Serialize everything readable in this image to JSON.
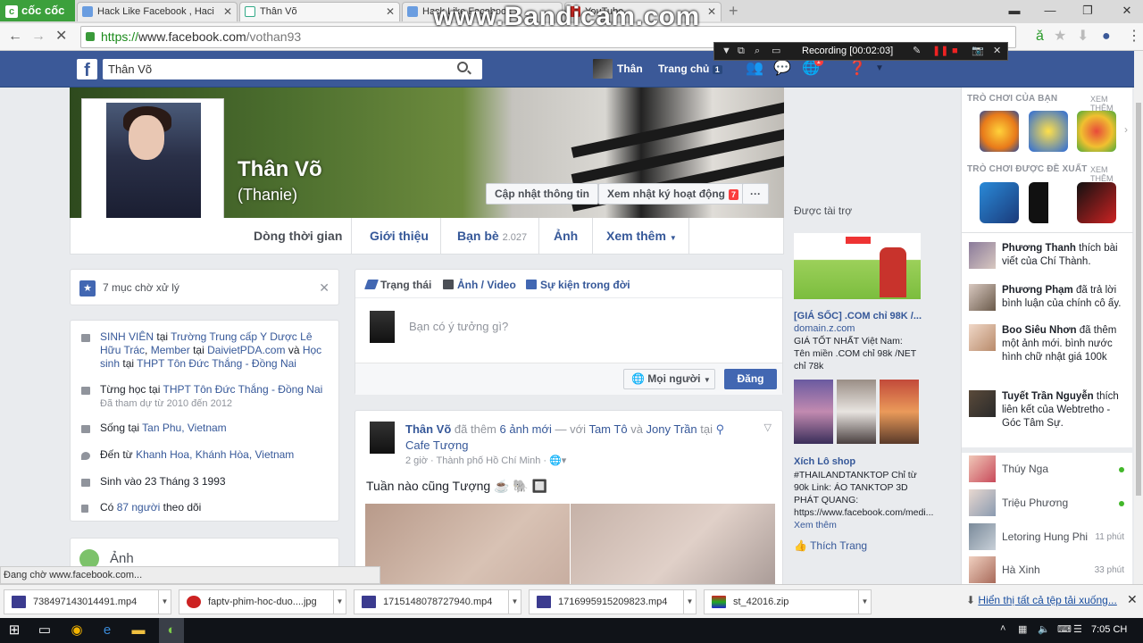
{
  "browser": {
    "brand": "cốc cốc",
    "tabs": [
      {
        "title": "Hack Like Facebook , Haci",
        "active": false
      },
      {
        "title": "Thân Võ",
        "active": true
      },
      {
        "title": "Hack Like Facebook",
        "active": false
      },
      {
        "title": "YouTube",
        "active": false
      }
    ],
    "url_scheme": "https://",
    "url_host": "www.facebook.com",
    "url_path": "/vothan93",
    "status_text": "Đang chờ www.facebook.com..."
  },
  "recorder": {
    "watermark": "www.Bandicam.com",
    "recording_label": "Recording [00:02:03]"
  },
  "fb_header": {
    "search_value": "Thân Võ",
    "profile_link": "Thân",
    "home_link": "Trang chủ",
    "home_count": "1",
    "notif_count": "1"
  },
  "profile": {
    "name": "Thân Võ",
    "alternate_name": "(Thanie)",
    "update_info_btn": "Cập nhật thông tin",
    "activity_log_btn": "Xem nhật ký hoạt động",
    "activity_log_count": "7",
    "more_btn": "···",
    "tabs": {
      "timeline": "Dòng thời gian",
      "about": "Giới thiệu",
      "friends": "Bạn bè",
      "friends_count": "2.027",
      "photos": "Ảnh",
      "more": "Xem thêm"
    }
  },
  "pending": {
    "label": "7 mục chờ xử lý"
  },
  "intro": {
    "work_1": "SINH VIÊN",
    "work_at": "tại",
    "work_2": "Trường Trung cấp Y Dược Lê Hữu Trác",
    "work_3": "Member",
    "work_4": "DaivietPDA.com",
    "work_and": "và",
    "work_5": "Học sinh",
    "work_6": "THPT Tôn Đức Thắng - Đồng Nai",
    "edu_prefix": "Từng học tại",
    "edu_school": "THPT Tôn Đức Thắng - Đồng Nai",
    "edu_years": "Đã tham dự từ 2010 đến 2012",
    "lives_prefix": "Sống tại",
    "lives_place": "Tan Phu, Vietnam",
    "from_prefix": "Đến từ",
    "from_place": "Khanh Hoa, Khánh Hòa, Vietnam",
    "birthday": "Sinh vào 23 Tháng 3 1993",
    "followers_prefix": "Có",
    "followers_link": "87 người",
    "followers_suffix": "theo dõi"
  },
  "photos_card": {
    "title": "Ảnh"
  },
  "composer": {
    "status_tab": "Trạng thái",
    "photo_tab": "Ảnh / Video",
    "life_event_tab": "Sự kiện trong đời",
    "placeholder": "Bạn có ý tưởng gì?",
    "audience": "Mọi người",
    "post_btn": "Đăng"
  },
  "post": {
    "author": "Thân Võ",
    "action": "đã thêm",
    "photos_link": "6 ảnh mới",
    "with_text": "— với",
    "tag1": "Tam Tô",
    "and_text": "và",
    "tag2": "Jony Trần",
    "at_text": "tại",
    "place": "Cafe Tượng",
    "time": "2 giờ · Thành phố Hồ Chí Minh ·",
    "body": "Tuần nào cũng Tượng ☕ 🐘 🔲"
  },
  "sponsored": {
    "title": "Được tài trợ",
    "ad1_title": "[GIÁ SỐC] .COM chỉ 98K /...",
    "ad1_domain": "domain.z.com",
    "ad1_body": "GIÁ TỐT NHẤT Việt Nam: Tên miền .COM chỉ 98k /NET chỉ 78k",
    "ad2_title": "Xích Lô shop",
    "ad2_body": "#THAILANDTANKTOP Chỉ từ 90k Link: ÁO TANKTOP 3D PHÁT QUANG: https://www.facebook.com/medi...",
    "ad2_more": "Xem thêm",
    "like_page": "Thích Trang"
  },
  "rightbar": {
    "games_heading": "TRÒ CHƠI CỦA BẠN",
    "games_more": "XEM THÊM",
    "suggested_heading": "TRÒ CHƠI ĐƯỢC ĐỀ XUẤT",
    "suggested_more": "XEM THÊM",
    "ticker": [
      {
        "name": "Phương Thanh",
        "text": "thích bài viết của Chí Thành."
      },
      {
        "name": "Phương Phạm",
        "text": "đã trả lời bình luận của chính cô ấy."
      },
      {
        "name": "Boo Siêu Nhơn",
        "text": "đã thêm một ảnh mới. bình nước hình chữ nhật giá 100k"
      },
      {
        "name": "Tuyết Trần Nguyễn",
        "text": "thích liên kết của Webtretho - Góc Tâm Sự."
      }
    ],
    "contacts": [
      {
        "name": "Thúy Nga",
        "status": "online",
        "ago": ""
      },
      {
        "name": "Triệu Phương",
        "status": "online",
        "ago": ""
      },
      {
        "name": "Letoring Hung Phi",
        "status": "idle",
        "ago": "11 phút"
      },
      {
        "name": "Hà Xinh",
        "status": "idle",
        "ago": "33 phút"
      }
    ]
  },
  "downloads": {
    "items": [
      "738497143014491.mp4",
      "faptv-phim-hoc-duo....jpg",
      "1715148078727940.mp4",
      "1716995915209823.mp4",
      "st_42016.zip"
    ],
    "show_all": "Hiển thị tất cả tệp tải xuống..."
  },
  "taskbar": {
    "time": "7:05 CH"
  },
  "colors": {
    "fb_blue": "#3b5998",
    "link": "#365899",
    "button_blue": "#4267b2"
  }
}
